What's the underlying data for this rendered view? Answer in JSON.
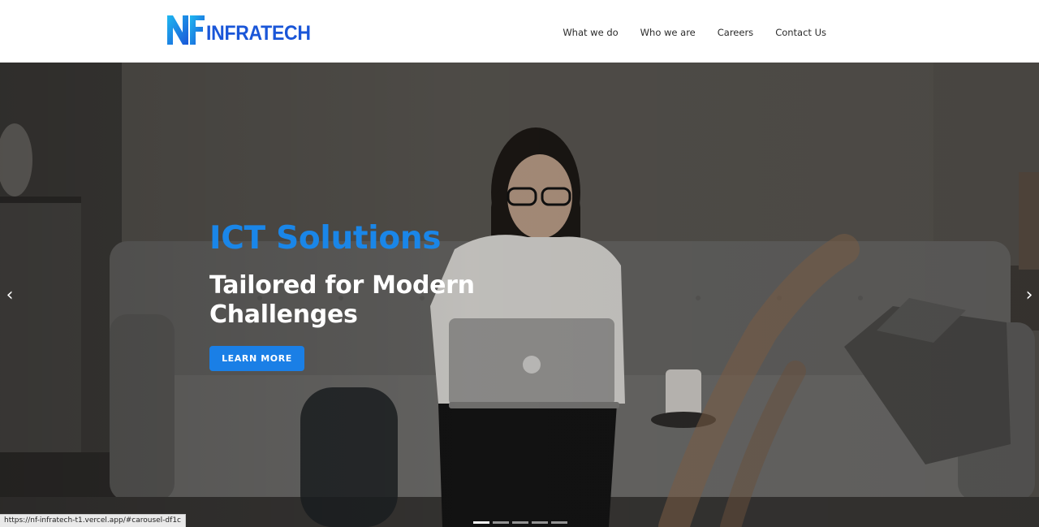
{
  "brand": {
    "logo_mark": "NF",
    "logo_text": "INFRATECH",
    "color": "#1a56d8"
  },
  "nav": {
    "items": [
      {
        "label": "What we do"
      },
      {
        "label": "Who we are"
      },
      {
        "label": "Careers"
      },
      {
        "label": "Contact Us"
      }
    ]
  },
  "hero": {
    "title": "ICT Solutions",
    "subtitle": "Tailored for Modern Challenges",
    "cta_label": "LEARN MORE",
    "accent_color": "#1a86e8",
    "prev_icon": "chevron-left-icon",
    "next_icon": "chevron-right-icon",
    "prev_glyph": "‹",
    "next_glyph": "›",
    "slide_count": 5,
    "active_slide": 1,
    "image_description_icon": "woman-with-laptop-photo"
  },
  "status_bar": {
    "url": "https://nf-infratech-t1.vercel.app/#carousel-df1c"
  }
}
